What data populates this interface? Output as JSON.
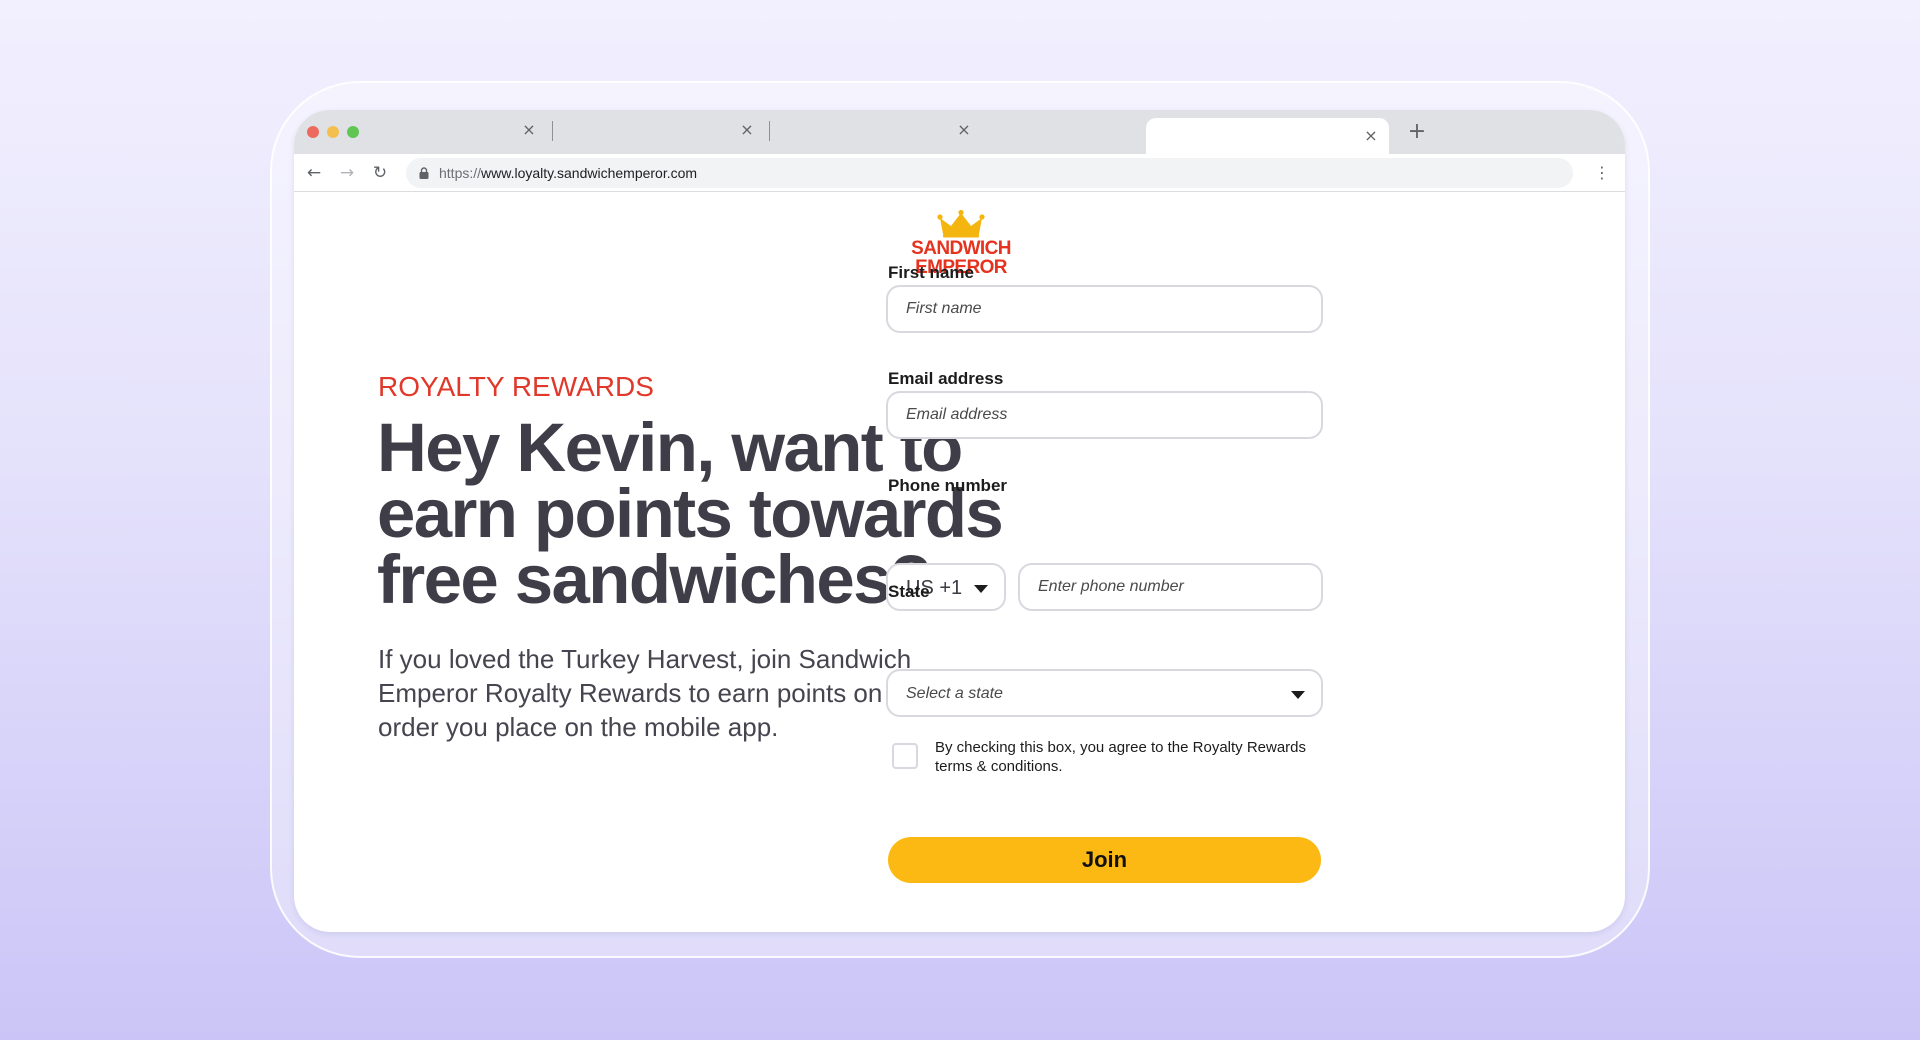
{
  "browser": {
    "url_scheme": "https://",
    "url_host": "www.loyalty.sandwichemperor.com",
    "new_tab_glyph": "+",
    "tab_close_glyph": "×",
    "back_glyph": "←",
    "forward_glyph": "→",
    "reload_glyph": "↻",
    "menu_glyph": "⋮"
  },
  "logo": {
    "line1": "SANDWICH",
    "line2": "EMPEROR",
    "crown_color": "#f5b50f",
    "brand_color": "#e5331f"
  },
  "hero": {
    "eyebrow": "ROYALTY REWARDS",
    "headline": "Hey Kevin, want to earn points towards free sandwiches?",
    "subtext": "If you loved the Turkey Harvest, join Sandwich Emperor Royalty Rewards to earn points on every order you place on the mobile app."
  },
  "form": {
    "first_name": {
      "label": "First name",
      "placeholder": "First name",
      "value": ""
    },
    "email": {
      "label": "Email address",
      "placeholder": "Email address",
      "value": ""
    },
    "phone": {
      "label": "Phone number",
      "country_code": "US +1",
      "placeholder": "Enter phone number",
      "value": ""
    },
    "state": {
      "label": "State",
      "selected": "Select a state"
    },
    "consent": {
      "checked": false,
      "text": "By checking this box, you agree to the Royalty Rewards terms & conditions."
    },
    "submit_label": "Join"
  },
  "colors": {
    "accent": "#fdb913",
    "eyebrow": "#e0392b",
    "headline": "#3e3d48"
  }
}
